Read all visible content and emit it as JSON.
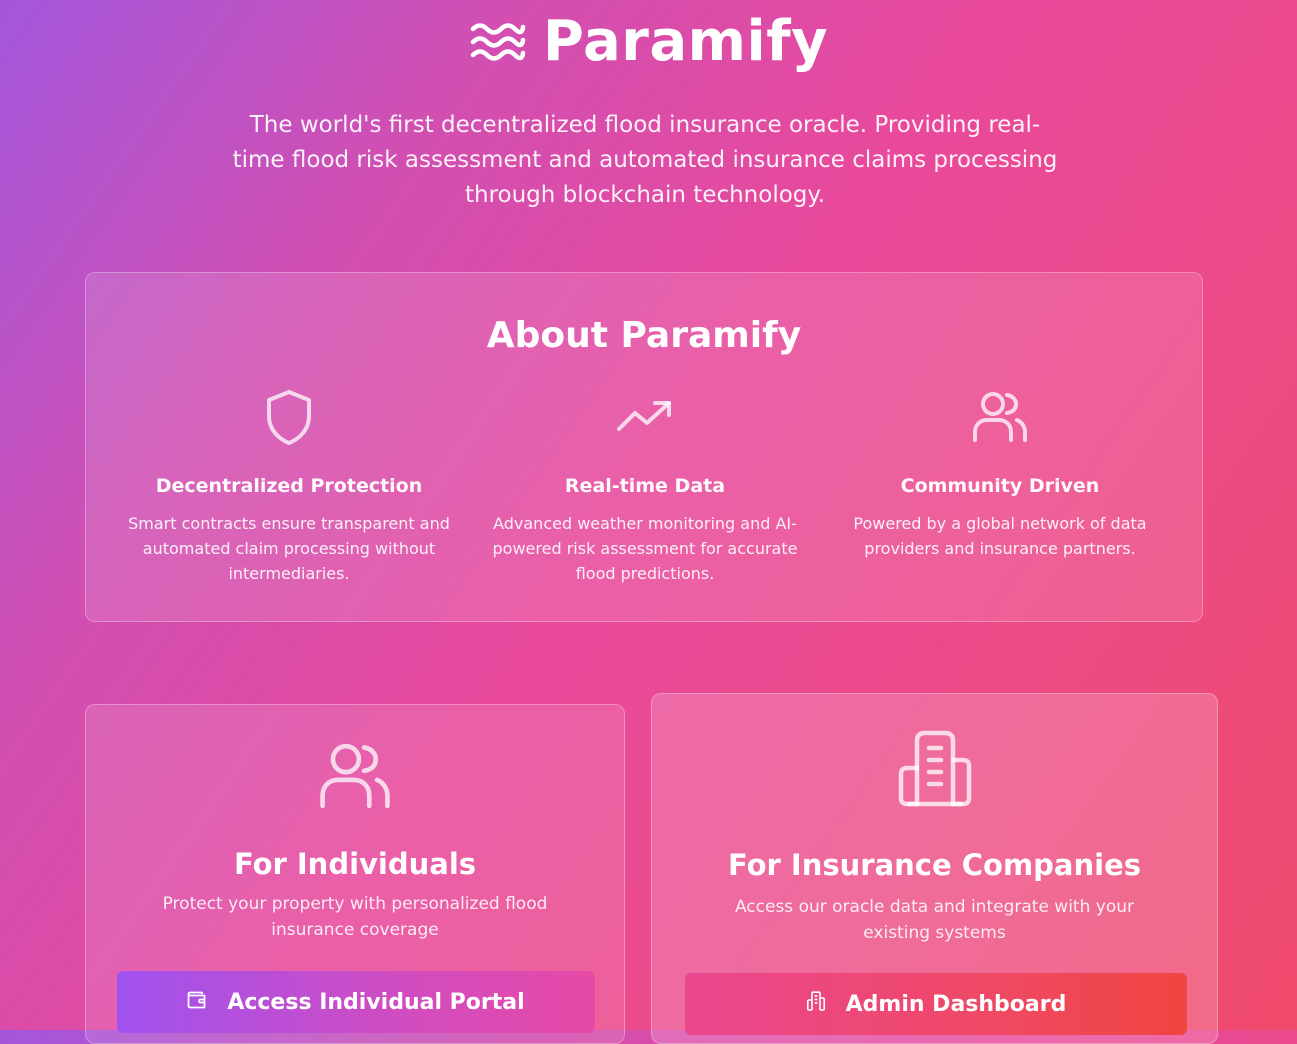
{
  "header": {
    "brand_icon": "waves-icon",
    "title": "Paramify",
    "tagline": "The world's first decentralized flood insurance oracle. Providing real-time flood risk assessment and automated insurance claims processing through blockchain technology."
  },
  "about": {
    "title": "About Paramify",
    "features": [
      {
        "icon": "shield-icon",
        "title": "Decentralized Protection",
        "description": "Smart contracts ensure transparent and automated claim processing without intermediaries."
      },
      {
        "icon": "trending-up-icon",
        "title": "Real-time Data",
        "description": "Advanced weather monitoring and AI-powered risk assessment for accurate flood predictions."
      },
      {
        "icon": "users-icon",
        "title": "Community Driven",
        "description": "Powered by a global network of data providers and insurance partners."
      }
    ]
  },
  "cards": {
    "individuals": {
      "icon": "users-icon",
      "title": "For Individuals",
      "description": "Protect your property with personalized flood insurance coverage",
      "button_icon": "wallet-icon",
      "button_label": "Access Individual Portal"
    },
    "companies": {
      "icon": "building-icon",
      "title": "For Insurance Companies",
      "description": "Access our oracle data and integrate with your existing systems",
      "button_icon": "building-icon",
      "button_label": "Admin Dashboard"
    }
  },
  "colors": {
    "gradient_start": "#a356dc",
    "gradient_end": "#ef4a6a",
    "individual_button_start": "#a052f0",
    "company_button_end": "#f14540"
  }
}
